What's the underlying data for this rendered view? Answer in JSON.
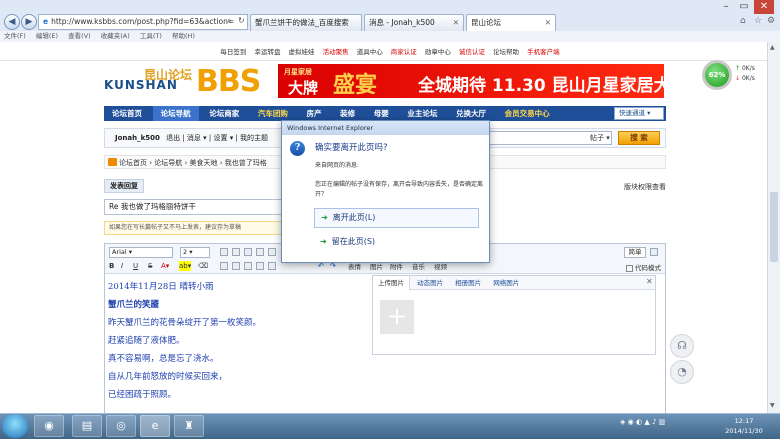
{
  "browser": {
    "address": "http://www.ksbbs.com/post.php?fid=63&action=",
    "tabs": [
      {
        "label": "蟹爪兰饼干的做法_百度搜索"
      },
      {
        "label": "消息 - Jonah_k500"
      },
      {
        "label": "昆山论坛"
      }
    ],
    "menu": [
      "文件(F)",
      "编辑(E)",
      "查看(V)",
      "收藏夹(A)",
      "工具(T)",
      "帮助(H)"
    ]
  },
  "site": {
    "top_links": [
      "每日签到",
      "幸运转盘",
      "虚拟娃娃",
      "活动聚焦",
      "道具中心",
      "商家认证",
      "勋章中心",
      "诚信认证",
      "论坛帮助",
      "手机客户端"
    ],
    "logo_latin": "KUNSHAN",
    "logo_cn": "昆山论坛",
    "logo_bbs": "BBS",
    "banner": {
      "brand": "月星家居",
      "big1": "大牌",
      "big2": "盛宴",
      "main": "全城期待 11.30 昆山月星家居大厅"
    },
    "speed": {
      "percent": "62%",
      "up": "0K/s",
      "down": "0K/s"
    },
    "nav": [
      "论坛首页",
      "论坛导航",
      "论坛商家",
      "汽车团购",
      "房产",
      "装修",
      "母婴",
      "业主论坛",
      "兑换大厅",
      "会员交易中心"
    ],
    "nav_quick": "快速通道",
    "user": {
      "name": "Jonah_k500",
      "logout": "退出",
      "msg": "消息",
      "settings": "设置",
      "mytopic": "我的主题"
    },
    "search_type": "帖子",
    "search_button": "搜 索",
    "breadcrumb": "论坛首页 › 论坛导航 › 美食天地 › 我也曾了玛格"
  },
  "editor": {
    "tab": "发表回复",
    "perm": "版块权限查看",
    "subject": "Re 我也做了玛格丽特饼干",
    "warning": "如果您在写长篇帖子又不马上发表，建议存为草稿",
    "font": "Arial",
    "size": "2",
    "simple": "简单",
    "codemode": "代码模式",
    "media_labels": [
      "表情",
      "图片",
      "附件",
      "音乐",
      "视频"
    ],
    "content": [
      "2014年11月28日 晴转小雨",
      "蟹爪兰的笑靥",
      "昨天蟹爪兰的花骨朵绽开了第一枚笑颜。",
      "赶紧追随了液体肥。",
      "真不容易啊，总是忘了浇水。",
      "自从几年前怒放的时候买回来，",
      "已经困疏于照顾。"
    ]
  },
  "image_panel": {
    "tabs": [
      "上传图片",
      "动态图片",
      "相册图片",
      "网络图片"
    ],
    "add": "+"
  },
  "dialog": {
    "window_title": "Windows Internet Explorer",
    "question": "确实要离开此页吗?",
    "source": "来自网页的消息:",
    "message": "您正在编辑的帖子没有保存，离开会导致内容丢失，是否确定离开？",
    "leave": "离开此页(L)",
    "stay": "留在此页(S)"
  },
  "taskbar": {
    "time": "12:17",
    "date": "2014/11/30"
  }
}
